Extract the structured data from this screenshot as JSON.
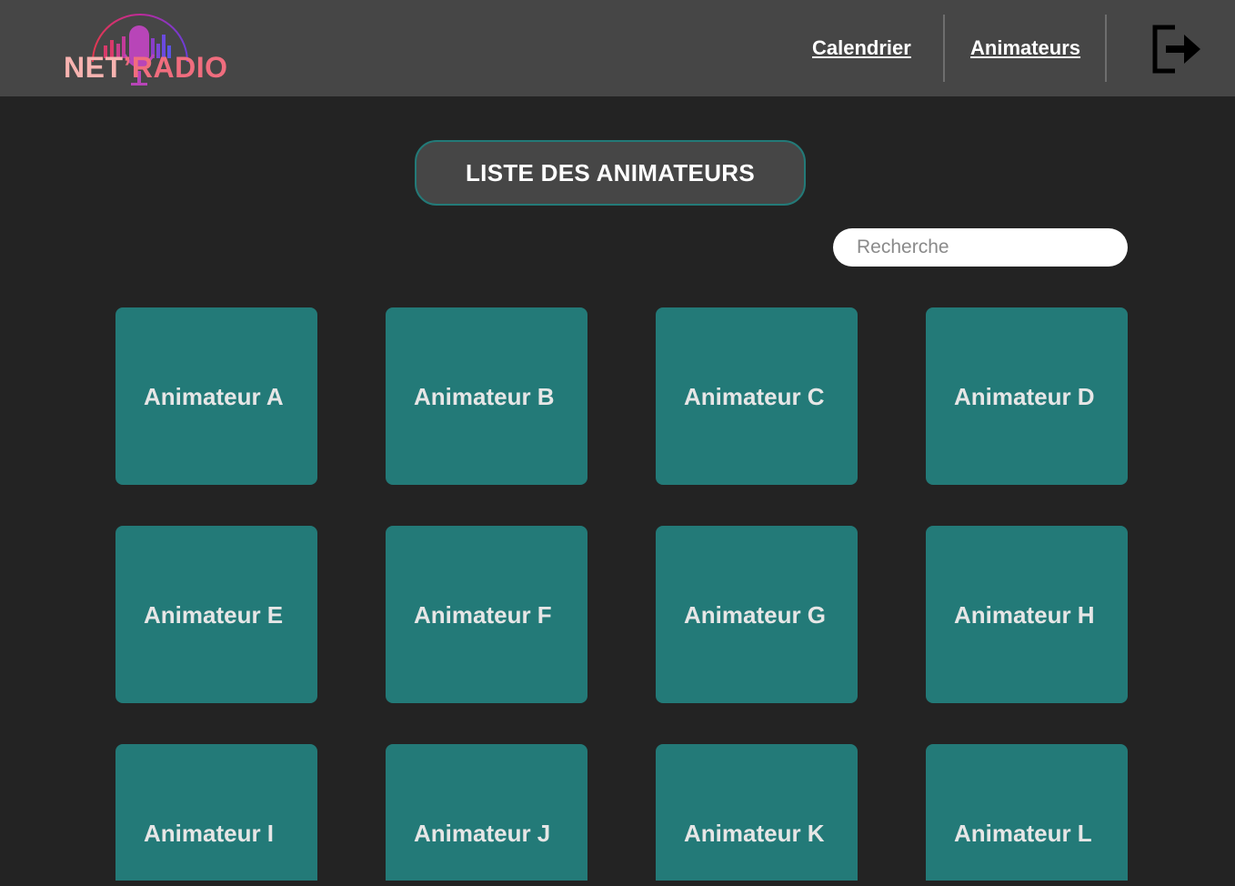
{
  "header": {
    "logo": {
      "text_net": "NET",
      "text_apostrophe": "’",
      "text_radio": "RADIO"
    },
    "nav": [
      {
        "label": "Calendrier"
      },
      {
        "label": "Animateurs"
      }
    ],
    "logout_icon": "logout-icon"
  },
  "main": {
    "title": "LISTE DES ANIMATEURS",
    "search": {
      "placeholder": "Recherche",
      "value": ""
    },
    "animateurs": [
      {
        "name": "Animateur A"
      },
      {
        "name": "Animateur B"
      },
      {
        "name": "Animateur C"
      },
      {
        "name": "Animateur D"
      },
      {
        "name": "Animateur E"
      },
      {
        "name": "Animateur F"
      },
      {
        "name": "Animateur G"
      },
      {
        "name": "Animateur H"
      },
      {
        "name": "Animateur I"
      },
      {
        "name": "Animateur J"
      },
      {
        "name": "Animateur K"
      },
      {
        "name": "Animateur L"
      }
    ]
  },
  "colors": {
    "header_bg": "#464646",
    "page_bg": "#232323",
    "card_bg": "#237a78",
    "logo_net": "#f7b3b0",
    "logo_radio": "#f06d7e"
  }
}
